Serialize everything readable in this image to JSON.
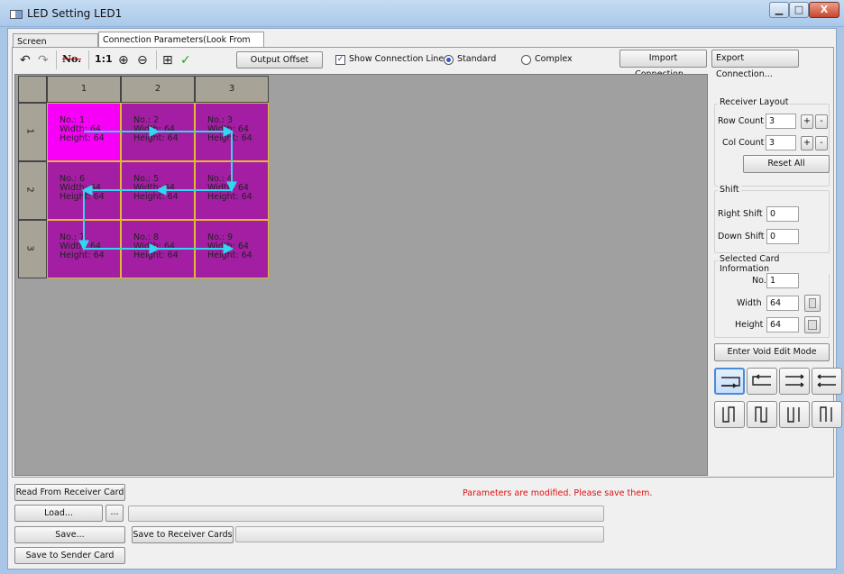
{
  "window": {
    "title": "LED Setting LED1",
    "min_glyph": "▁",
    "max_glyph": "□",
    "close_glyph": "X"
  },
  "tabs": [
    {
      "label": "Screen Parameters"
    },
    {
      "label": "Connection Parameters(Look From Front)"
    }
  ],
  "toolbar": {
    "undo_icon": "↶",
    "redo_icon": "↷",
    "no_label": "No.",
    "one_to_one": "1:1",
    "zoom_in_icon": "⊕",
    "zoom_out_icon": "⊖",
    "grid_icon": "⊞",
    "check_icon": "✓",
    "output_offset": "Output Offset",
    "show_lines_label": "Show Connection Lines",
    "show_lines_checked": true,
    "standard_label": "Standard",
    "complex_label": "Complex",
    "import": "Import Connection...",
    "export": "Export Connection..."
  },
  "grid": {
    "col_headers": [
      "1",
      "2",
      "3"
    ],
    "row_headers": [
      "1",
      "2",
      "3"
    ],
    "cells": [
      {
        "no": "No.: 1",
        "width": "Width: 64",
        "height": "Height: 64",
        "selected": true
      },
      {
        "no": "No.: 2",
        "width": "Width: 64",
        "height": "Height: 64",
        "selected": false
      },
      {
        "no": "No.: 3",
        "width": "Width: 64",
        "height": "Height: 64",
        "selected": false
      },
      {
        "no": "No.: 6",
        "width": "Width: 64",
        "height": "Height: 64",
        "selected": false
      },
      {
        "no": "No.: 5",
        "width": "Width: 64",
        "height": "Height: 64",
        "selected": false
      },
      {
        "no": "No.: 4",
        "width": "Width: 64",
        "height": "Height: 64",
        "selected": false
      },
      {
        "no": "No.: 7",
        "width": "Width: 64",
        "height": "Height: 64",
        "selected": false
      },
      {
        "no": "No.: 8",
        "width": "Width: 64",
        "height": "Height: 64",
        "selected": false
      },
      {
        "no": "No.: 9",
        "width": "Width: 64",
        "height": "Height: 64",
        "selected": false
      }
    ],
    "colors": {
      "cell": "#a31ea3",
      "selected_cell": "#f700f7",
      "cell_border": "#e5b833",
      "line": "#33d6f0",
      "canvas": "#a0a0a0"
    }
  },
  "receiver_layout": {
    "title": "Receiver Layout",
    "row_label": "Row Count",
    "row_value": "3",
    "col_label": "Col Count",
    "col_value": "3",
    "plus": "+",
    "minus": "-",
    "reset": "Reset All"
  },
  "shift": {
    "title": "Shift",
    "right_label": "Right Shift",
    "right_value": "0",
    "down_label": "Down Shift",
    "down_value": "0"
  },
  "selected_card": {
    "title": "Selected Card Information",
    "no_label": "No.",
    "no_value": "1",
    "width_label": "Width",
    "width_value": "64",
    "height_label": "Height",
    "height_value": "64"
  },
  "void_edit": "Enter Void Edit Mode",
  "bottom": {
    "read": "Read From Receiver Card",
    "load": "Load...",
    "browse": "...",
    "save": "Save...",
    "save_receivers": "Save to Receiver Cards",
    "save_sender": "Save to Sender Card",
    "status": "Parameters are modified. Please save them.",
    "status_color": "#e01010"
  }
}
